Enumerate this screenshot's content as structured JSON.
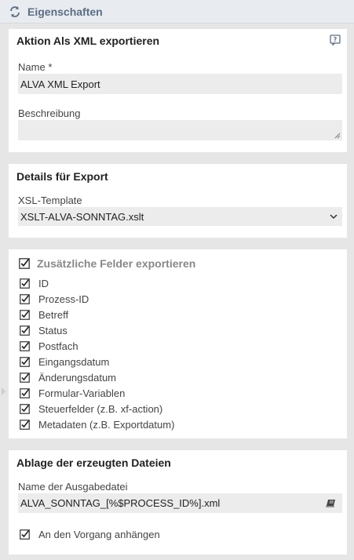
{
  "header": {
    "title": "Eigenschaften",
    "icon": "refresh-icon"
  },
  "action": {
    "title": "Aktion Als XML exportieren",
    "name_label": "Name",
    "required_mark": "*",
    "name_value": "ALVA XML Export",
    "description_label": "Beschreibung",
    "description_value": ""
  },
  "export": {
    "title": "Details für Export",
    "xsl_label": "XSL-Template",
    "xsl_value": "XSLT-ALVA-SONNTAG.xslt"
  },
  "fields": {
    "title": "Zusätzliche Felder exportieren",
    "items": [
      "ID",
      "Prozess-ID",
      "Betreff",
      "Status",
      "Postfach",
      "Eingangsdatum",
      "Änderungsdatum",
      "Formular-Variablen",
      "Steuerfelder (z.B. xf-action)",
      "Metadaten (z.B. Exportdatum)"
    ]
  },
  "storage": {
    "title": "Ablage der erzeugten Dateien",
    "filename_label": "Name der Ausgabedatei",
    "filename_value": "ALVA_SONNTAG_[%$PROCESS_ID%].xml",
    "attach_label": "An den Vorgang anhängen"
  },
  "colors": {
    "header_text": "#5a6e85",
    "field_bg": "#ececec",
    "page_bg": "#e6e6e6"
  }
}
